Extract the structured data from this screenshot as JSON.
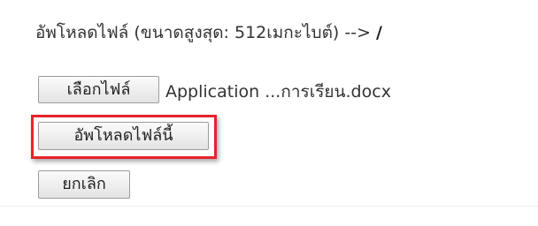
{
  "upload": {
    "header_text": "อัพโหลดไฟล์ (ขนาดสูงสุด: 512เมกะไบต์) -->",
    "path": "/",
    "choose_file_label": "เลือกไฟล์",
    "selected_file_name": "Application ...การเรียน.docx",
    "upload_button_label": "อัพโหลดไฟล์นี้",
    "cancel_button_label": "ยกเลิก"
  },
  "colors": {
    "highlight_border": "#e8222a",
    "button_border": "#9c9c9c",
    "text": "#333333"
  }
}
